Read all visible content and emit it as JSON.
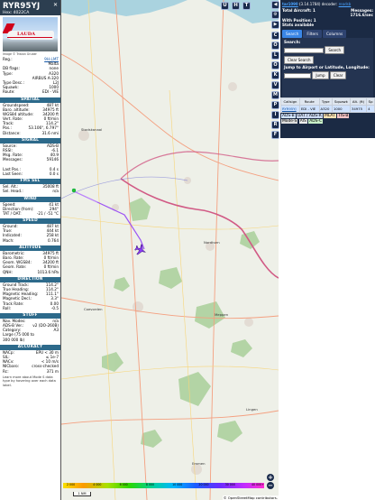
{
  "left_panel": {
    "callsign": "RYR95YJ",
    "hex_label": "Hex: 4022CA",
    "close": "✕",
    "photo_credit": "Image © Tristan Gruber",
    "airline_logo": "LAUDA",
    "basic": [
      {
        "k": "Reg.:",
        "v": "9H-LMT",
        "link": true
      },
      {
        "k": "",
        "v": "Malta",
        "link": false
      },
      {
        "k": "DB flags:",
        "v": "none",
        "link": false
      },
      {
        "k": "Type:",
        "v": "A320",
        "link": false
      },
      {
        "k": "",
        "v": "AIRBUS A-320",
        "link": false
      },
      {
        "k": "Type Desc.:",
        "v": "L2J",
        "link": false
      },
      {
        "k": "Squawk:",
        "v": "1000",
        "link": false
      },
      {
        "k": "Route:",
        "v": "EDI - VIE",
        "link": false
      }
    ],
    "sections": [
      {
        "title": "SPATIAL",
        "rows": [
          {
            "k": "Groundspeed:",
            "v": "487 kt"
          },
          {
            "k": "Baro. altitude:",
            "v": "34975 ft"
          },
          {
            "k": "WGS84 altitude:",
            "v": "34200 ft"
          },
          {
            "k": "Vert. Rate:",
            "v": "0 ft/min"
          },
          {
            "k": "Track:",
            "v": "114.2°"
          },
          {
            "k": "Pos.:",
            "v": "53.106°, 6.797°"
          },
          {
            "k": "Distance:",
            "v": "31.6 nmi"
          }
        ]
      },
      {
        "title": "SIGNAL",
        "rows": [
          {
            "k": "Source:",
            "v": "ADS-B"
          },
          {
            "k": "RSSI:",
            "v": "-6.1"
          },
          {
            "k": "Msg. Rate:",
            "v": "40.9"
          },
          {
            "k": "Messages:",
            "v": "59146"
          },
          {
            "k": "",
            "v": ""
          },
          {
            "k": "Last Pos.:",
            "v": "0.4 s"
          },
          {
            "k": "Last Seen:",
            "v": "0.0 s"
          }
        ]
      },
      {
        "title": "FMS SEL",
        "rows": [
          {
            "k": "Sel. Alt.:",
            "v": "35008 ft"
          },
          {
            "k": "Sel. Head.:",
            "v": "n/a"
          }
        ]
      },
      {
        "title": "WIND",
        "rows": [
          {
            "k": "Speed:",
            "v": "41 kt"
          },
          {
            "k": "Direction (from):",
            "v": "294°"
          },
          {
            "k": "TAT / OAT:",
            "v": "-21 / -51 °C"
          }
        ]
      },
      {
        "title": "SPEED",
        "rows": [
          {
            "k": "Ground:",
            "v": "487 kt"
          },
          {
            "k": "True:",
            "v": "444 kt"
          },
          {
            "k": "Indicated:",
            "v": "258 kt"
          },
          {
            "k": "Mach:",
            "v": "0.764"
          }
        ]
      },
      {
        "title": "ALTITUDE",
        "rows": [
          {
            "k": "Barometric:",
            "v": "34975 ft"
          },
          {
            "k": "Baro. Rate:",
            "v": "0 ft/min"
          },
          {
            "k": "Geom. WGS84:",
            "v": "34200 ft"
          },
          {
            "k": "Geom. Rate:",
            "v": "0 ft/min"
          },
          {
            "k": "QNH:",
            "v": "1013.6 hPa"
          }
        ]
      },
      {
        "title": "DIRECTION",
        "rows": [
          {
            "k": "Ground Track:",
            "v": "114.2°"
          },
          {
            "k": "True Heading:",
            "v": "114.2°"
          },
          {
            "k": "Magnetic Heading:",
            "v": "111.1°"
          },
          {
            "k": "Magnetic Decl.:",
            "v": "3.3°"
          },
          {
            "k": "Track Rate:",
            "v": "0.00"
          },
          {
            "k": "Roll:",
            "v": "-0.5"
          }
        ]
      },
      {
        "title": "STUFF",
        "rows": [
          {
            "k": "Nav. Modes:",
            "v": "n/a"
          },
          {
            "k": "ADS-B Ver.:",
            "v": "v2 (DO-260B)"
          },
          {
            "k": "Category:",
            "v": "A3"
          },
          {
            "k": "Large (75 000 to",
            "v": ""
          },
          {
            "k": "300 000 lb)",
            "v": ""
          }
        ]
      },
      {
        "title": "ACCURACY",
        "rows": [
          {
            "k": "NACp:",
            "v": "EPU < 30 m"
          },
          {
            "k": "SIL:",
            "v": "≤ 1e-7"
          },
          {
            "k": "NACv:",
            "v": "< 10 m/s"
          },
          {
            "k": "NICbaro:",
            "v": "cross-checked"
          },
          {
            "k": "Rc:",
            "v": "371 m"
          }
        ]
      }
    ],
    "note": "Learn more about Mode S data type by hovering over each data label."
  },
  "map": {
    "top_buttons": [
      "U",
      "H",
      "T"
    ],
    "colorbar_ticks": [
      "2 000",
      "4 000",
      "6 000",
      "8 000",
      "10 000",
      "20 000",
      "30 000",
      "40 000+"
    ],
    "scale_label": "1 NM",
    "zoom_in": "+",
    "zoom_out": "−",
    "attribution": "© OpenStreetMap contributors.",
    "towns": [
      "Emmen",
      "Meppen",
      "Coevorden",
      "Nordhorn",
      "Stadskanaal",
      "Lingen"
    ]
  },
  "toolstrip": [
    "◀",
    "⚙",
    "▶",
    "C",
    "O",
    "L",
    "O",
    "K",
    "V",
    "M",
    "P",
    "I",
    "R",
    "F"
  ],
  "right_panel": {
    "header_link": "tar1090",
    "header_rest": "(3.14.1784) decoder:",
    "header_ready": "readsb",
    "aircraft_label": "Total Aircraft: 1",
    "messages_label": "Messages:",
    "rate_label": "1716.6/sec",
    "position_label": "With Position: 1",
    "stats_label": "Stats available",
    "tabs": [
      "Search",
      "Filters",
      "Columns"
    ],
    "search_label": "Search:",
    "search_button": "Search",
    "clear_button": "Clear Search",
    "jump_label": "Jump to Airport or Latitude, Longitude:",
    "jump_button": "Jump",
    "jump_clear": "Clear",
    "table_headers": [
      "Callsign",
      "Route",
      "Type",
      "Squawk",
      "Alt. (ft)",
      "Sp"
    ],
    "table_row": [
      "RYR95YJ",
      "EDI - VIE",
      "A320",
      "1000",
      "34975",
      "4"
    ],
    "legend": [
      {
        "label": "ADS-B",
        "color": "#cfe2ff"
      },
      {
        "label": "UAT / ADS-R",
        "color": "#c8d6ef"
      },
      {
        "label": "MLAT",
        "color": "#fde3b4"
      },
      {
        "label": "TIS-B",
        "color": "#f6c4c7"
      },
      {
        "label": "Mode-S",
        "color": "#dddddd"
      },
      {
        "label": "AIS",
        "color": "#eeeeee"
      },
      {
        "label": "ADS-C",
        "color": "#c9f0c9"
      }
    ],
    "colors": {
      "header": "#1b2a44",
      "link": "#4aa3ff",
      "row_highlight": "#cfe2ff"
    }
  }
}
